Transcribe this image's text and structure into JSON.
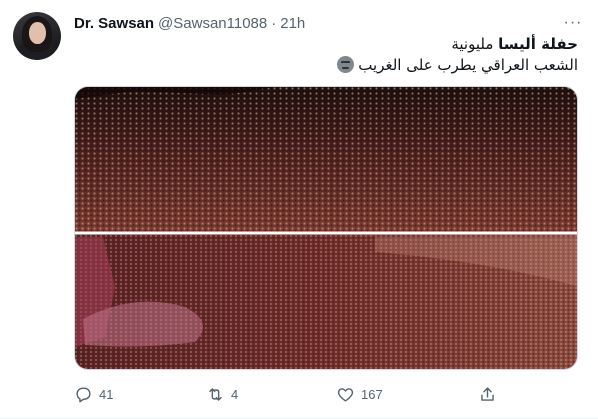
{
  "tweet": {
    "display_name": "Dr. Sawsan",
    "handle": "@Sawsan11088",
    "separator": "·",
    "time": "21h",
    "more_glyph": "···",
    "line1_bold": "حفلة أليسا",
    "line1_rest": "مليونية",
    "line2": "الشعب العراقي يطرب على الغريب",
    "emoji_name": "grimacing-face-emoji"
  },
  "actions": {
    "reply_count": "41",
    "retweet_count": "4",
    "like_count": "167"
  },
  "colors": {
    "text": "#0f1419",
    "secondary": "#536471",
    "border": "#cfd9de"
  }
}
